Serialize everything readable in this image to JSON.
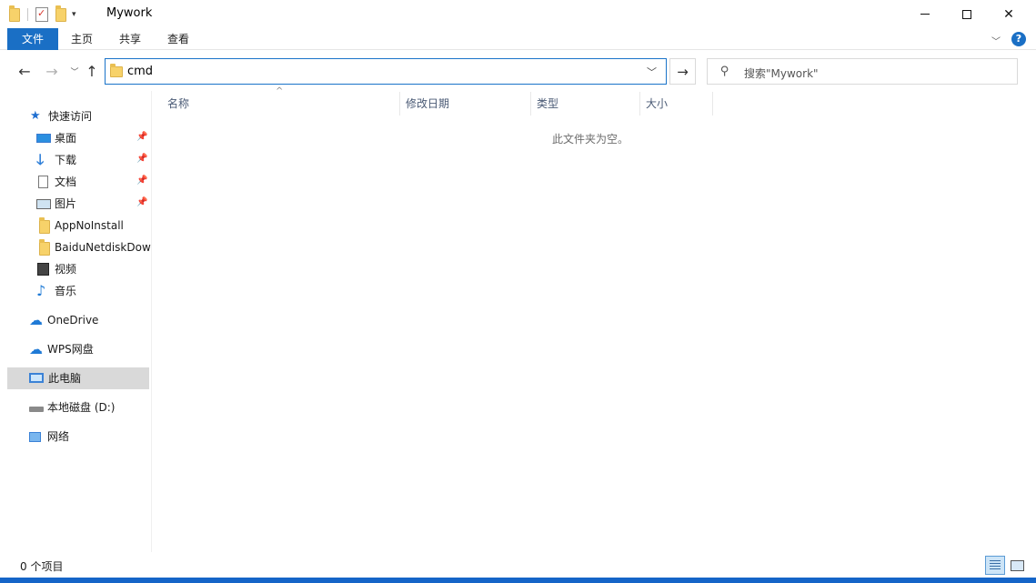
{
  "window": {
    "title": "Mywork",
    "qat_dropdown": "▾",
    "minimize_icon": "minimize-icon",
    "maximize_icon": "maximize-icon",
    "close_glyph": "✕"
  },
  "ribbon": {
    "tabs": [
      {
        "label": "文件"
      },
      {
        "label": "主页"
      },
      {
        "label": "共享"
      },
      {
        "label": "查看"
      }
    ],
    "expand_glyph": "﹀",
    "help_glyph": "?"
  },
  "nav": {
    "back_glyph": "←",
    "forward_glyph": "→",
    "recent_glyph": "﹀",
    "up_glyph": "↑"
  },
  "address": {
    "path": "cmd",
    "dropdown_glyph": "﹀",
    "go_glyph": "→"
  },
  "search": {
    "placeholder": "搜索\"Mywork\"",
    "icon_glyph": "⚲"
  },
  "sidebar": {
    "quick_access": {
      "label": "快速访问",
      "icon": "star-icon"
    },
    "items": [
      {
        "label": "桌面",
        "icon": "desktop-icon",
        "pinned": true
      },
      {
        "label": "下载",
        "icon": "download-icon",
        "pinned": true
      },
      {
        "label": "文档",
        "icon": "document-icon",
        "pinned": true
      },
      {
        "label": "图片",
        "icon": "pictures-icon",
        "pinned": true
      },
      {
        "label": "AppNoInstall",
        "icon": "folder-icon",
        "pinned": false
      },
      {
        "label": "BaiduNetdiskDow",
        "icon": "folder-icon",
        "pinned": false
      },
      {
        "label": "视频",
        "icon": "video-icon",
        "pinned": false
      },
      {
        "label": "音乐",
        "icon": "music-icon",
        "pinned": false
      }
    ],
    "onedrive": {
      "label": "OneDrive",
      "icon": "cloud-icon"
    },
    "wps": {
      "label": "WPS网盘",
      "icon": "cloud-icon"
    },
    "this_pc": {
      "label": "此电脑",
      "icon": "computer-icon",
      "selected": true
    },
    "drive_d": {
      "label": "本地磁盘 (D:)",
      "icon": "drive-icon"
    },
    "network": {
      "label": "网络",
      "icon": "network-icon"
    },
    "pin_glyph": "📌"
  },
  "columns": {
    "name": "名称",
    "date": "修改日期",
    "type": "类型",
    "size": "大小",
    "sort_glyph": "^"
  },
  "content": {
    "empty_message": "此文件夹为空。"
  },
  "status": {
    "item_count": "0 个项目"
  }
}
